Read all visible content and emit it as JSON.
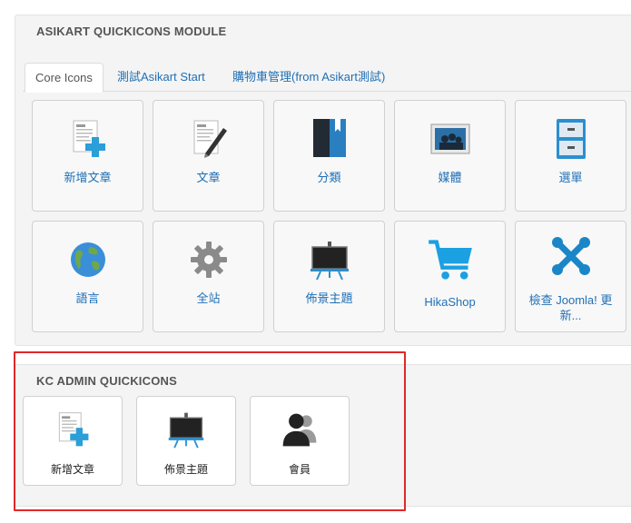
{
  "module1": {
    "title": "ASIKART QUICKICONS MODULE",
    "tabs": [
      {
        "label": "Core Icons",
        "active": true
      },
      {
        "label": "測試Asikart Start",
        "active": false
      },
      {
        "label": "購物車管理(from Asikart測試)",
        "active": false
      }
    ],
    "icons": [
      {
        "label": "新增文章",
        "icon": "add-article-icon"
      },
      {
        "label": "文章",
        "icon": "article-edit-icon"
      },
      {
        "label": "分類",
        "icon": "category-book-icon"
      },
      {
        "label": "媒體",
        "icon": "media-image-icon"
      },
      {
        "label": "選單",
        "icon": "menu-cabinet-icon"
      },
      {
        "label": "語言",
        "icon": "language-globe-icon"
      },
      {
        "label": "全站",
        "icon": "global-gear-icon"
      },
      {
        "label": "佈景主題",
        "icon": "template-board-icon"
      },
      {
        "label": "HikaShop",
        "icon": "shopping-cart-icon"
      },
      {
        "label": "檢查 Joomla! 更新...",
        "icon": "joomla-update-icon"
      }
    ]
  },
  "module2": {
    "title": "KC ADMIN QUICKICONS",
    "icons": [
      {
        "label": "新增文章",
        "icon": "add-article-icon"
      },
      {
        "label": "佈景主題",
        "icon": "template-board-icon"
      },
      {
        "label": "會員",
        "icon": "users-icon"
      }
    ]
  },
  "colors": {
    "link": "#1f6fb5",
    "highlight_box": "#e0282a",
    "module_bg": "#f4f4f4"
  }
}
